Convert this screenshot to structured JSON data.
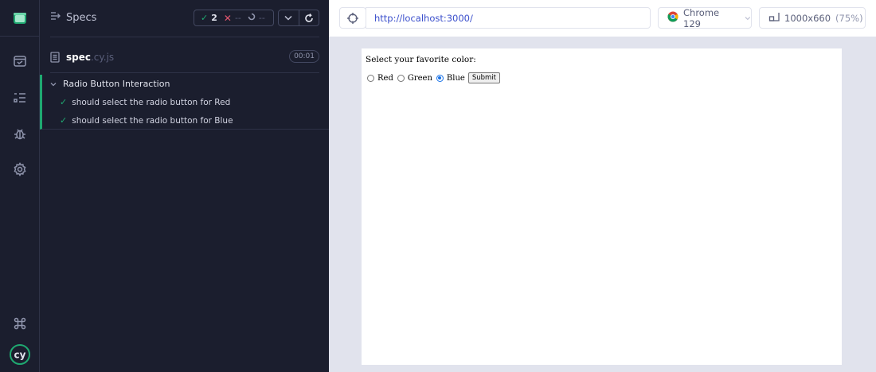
{
  "sidebar": {
    "icons": [
      "cypress-app-icon",
      "runs-icon",
      "specs-list-icon",
      "debug-icon",
      "settings-icon",
      "keyboard-shortcuts-icon",
      "cypress-logo"
    ]
  },
  "reporter": {
    "title": "Specs",
    "stats": {
      "passed": "2",
      "failed": "--",
      "pending": "--"
    },
    "spec": {
      "name": "spec",
      "ext": ".cy.js",
      "duration": "00:01"
    },
    "suite": {
      "title": "Radio Button Interaction",
      "tests": [
        {
          "label": "should select the radio button for Red",
          "status": "passed"
        },
        {
          "label": "should select the radio button for Blue",
          "status": "passed"
        }
      ]
    }
  },
  "toolbar": {
    "url": "http://localhost:3000/",
    "browser": "Chrome 129",
    "viewport": "1000x660",
    "viewport_scale": "(75%)"
  },
  "aut": {
    "question": "Select your favorite color:",
    "options": [
      {
        "label": "Red",
        "checked": false
      },
      {
        "label": "Green",
        "checked": false
      },
      {
        "label": "Blue",
        "checked": true
      }
    ],
    "submit_label": "Submit"
  },
  "colors": {
    "pass": "#1fa971",
    "fail": "#e45770",
    "accent": "#3b4fcc",
    "panel": "#1b1e2e"
  }
}
